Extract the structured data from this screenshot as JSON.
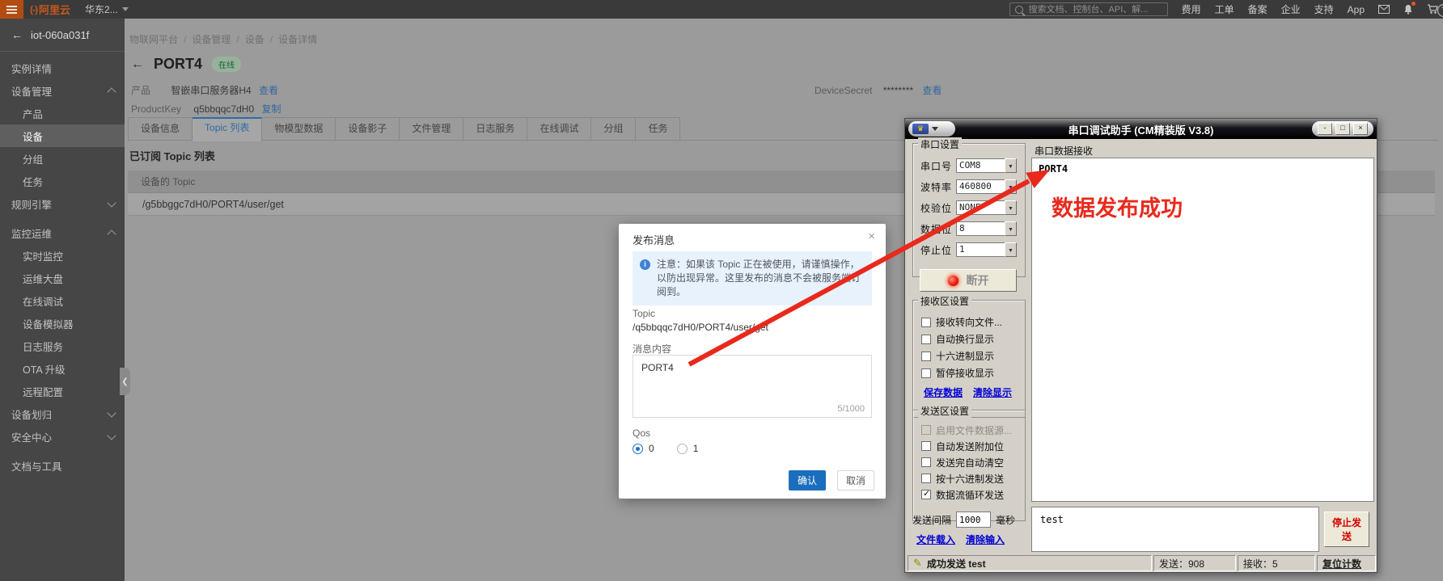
{
  "colors": {
    "accent_blue": "#2d6ca8",
    "brand_orange": "#c4571c",
    "annotation_red": "#e8291c",
    "badge_green_text": "#175f36",
    "confirm_blue": "#1b6dbe"
  },
  "topbar": {
    "brand_mark": "(-)",
    "brand": "阿里云",
    "region": "华东2...",
    "search_placeholder": "搜索文档、控制台、API、解...",
    "menu": [
      "费用",
      "工单",
      "备案",
      "企业",
      "支持",
      "App"
    ]
  },
  "sidebar": {
    "instance": "iot-060a031f",
    "items": [
      {
        "label": "实例详情"
      },
      {
        "label": "设备管理",
        "chevron": "up"
      },
      {
        "label": "产品"
      },
      {
        "label": "设备",
        "active": true
      },
      {
        "label": "分组"
      },
      {
        "label": "任务"
      },
      {
        "label": "规则引擎",
        "chevron": "down"
      },
      {
        "label": "监控运维",
        "chevron": "up"
      },
      {
        "label": "实时监控"
      },
      {
        "label": "运维大盘"
      },
      {
        "label": "在线调试"
      },
      {
        "label": "设备模拟器"
      },
      {
        "label": "日志服务"
      },
      {
        "label": "OTA 升级"
      },
      {
        "label": "远程配置"
      },
      {
        "label": "设备划归",
        "chevron": "down"
      },
      {
        "label": "安全中心",
        "chevron": "down"
      },
      {
        "label": "文档与工具"
      }
    ]
  },
  "content": {
    "breadcrumb": [
      "物联网平台",
      "设备管理",
      "设备",
      "设备详情"
    ],
    "device_name": "PORT4",
    "status": "在线",
    "info": {
      "product_label": "产品",
      "product_value": "智嵌串口服务器H4",
      "product_link": "查看",
      "productkey_label": "ProductKey",
      "productkey_value": "q5bbqqc7dH0",
      "productkey_link": "复制",
      "devicesecret_label": "DeviceSecret",
      "devicesecret_value": "********",
      "devicesecret_link": "查看"
    },
    "tabs": [
      "设备信息",
      "Topic 列表",
      "物模型数据",
      "设备影子",
      "文件管理",
      "日志服务",
      "在线调试",
      "分组",
      "任务"
    ],
    "section_title": "已订阅 Topic 列表",
    "table_header": "设备的 Topic",
    "topic_row": "/g5bbggc7dH0/PORT4/user/get"
  },
  "modal": {
    "title": "发布消息",
    "close_icon": "×",
    "info_icon": "i",
    "notice": "注意：如果该 Topic 正在被使用，请谨慎操作，以防出现异常。这里发布的消息不会被服务端订阅到。",
    "topic_label": "Topic",
    "topic_value": "/q5bbqqc7dH0/PORT4/user/get",
    "message_label": "消息内容",
    "message_value": "PORT4",
    "counter": "5/1000",
    "qos_label": "Qos",
    "qos_options": [
      "0",
      "1"
    ],
    "qos_selected": "0",
    "confirm": "确认",
    "cancel": "取消"
  },
  "serial": {
    "title": "串口调试助手 (CM精装版 V3.8)",
    "logo_glyph": "♛",
    "window_buttons": {
      "minimize": "-",
      "maximize": "□",
      "close": "×"
    },
    "port_group": {
      "title": "串口设置",
      "fields": [
        {
          "label": "串口号",
          "value": "COM8"
        },
        {
          "label": "波特率",
          "value": "460800"
        },
        {
          "label": "校验位",
          "value": "NONE"
        },
        {
          "label": "数据位",
          "value": "8"
        },
        {
          "label": "停止位",
          "value": "1"
        }
      ],
      "disconnect": "断开"
    },
    "recv_group": {
      "title": "接收区设置",
      "checks": [
        "接收转向文件...",
        "自动换行显示",
        "十六进制显示",
        "暂停接收显示"
      ],
      "links": [
        "保存数据",
        "清除显示"
      ]
    },
    "send_group": {
      "title": "发送区设置",
      "checks": [
        "启用文件数据源...",
        "自动发送附加位",
        "发送完自动清空",
        "按十六进制发送",
        "数据流循环发送"
      ],
      "checked_index": 4,
      "disabled_index": 0,
      "interval_label": "发送间隔",
      "interval_value": "1000",
      "interval_unit": "毫秒",
      "links": [
        "文件载入",
        "清除输入"
      ]
    },
    "recv_area": {
      "label": "串口数据接收",
      "content": "PORT4"
    },
    "send_value": "test",
    "stop_button": "停止发送",
    "status": {
      "message": "成功发送 test",
      "sent": "发送：908",
      "received": "接收：5",
      "reset": "复位计数"
    }
  },
  "annotation": {
    "text": "数据发布成功"
  }
}
